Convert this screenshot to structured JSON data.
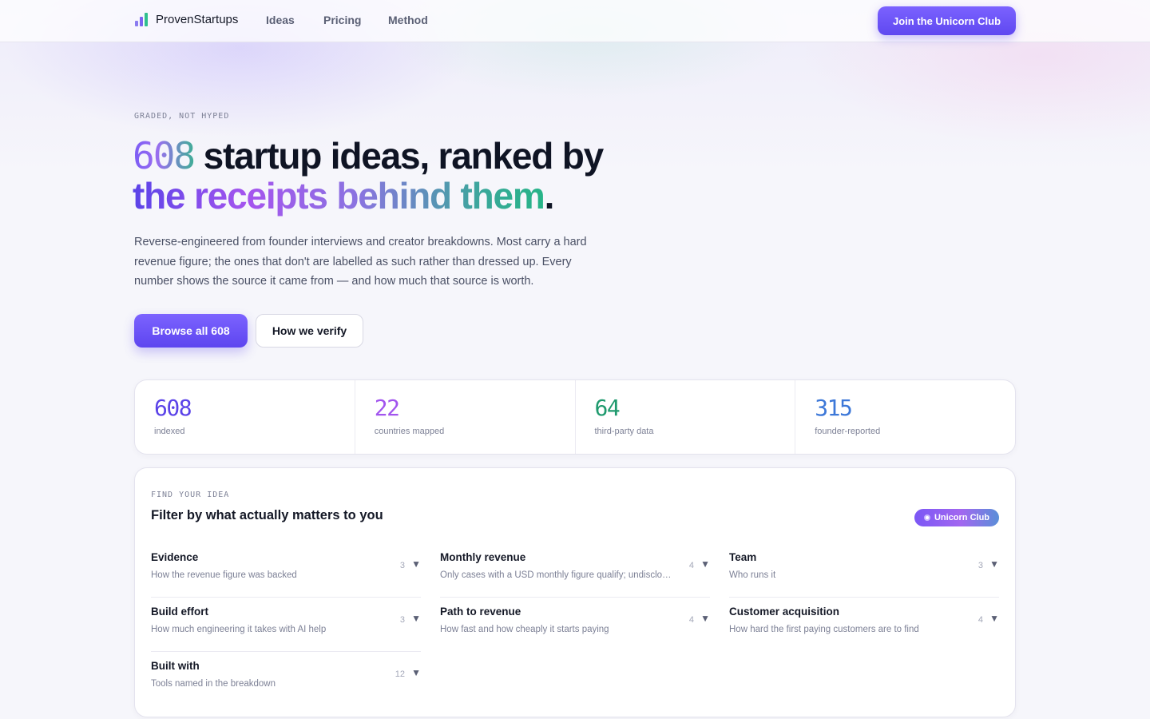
{
  "nav": {
    "brand": "ProvenStartups",
    "links": [
      "Ideas",
      "Pricing",
      "Method"
    ],
    "cta": "Join the Unicorn Club"
  },
  "hero": {
    "eyebrow": "GRADED, NOT HYPED",
    "headline_number": "608",
    "headline_rest_line1": " startup ideas, ranked by",
    "headline_gradient": "the receipts behind them",
    "headline_end": ".",
    "lede": "Reverse-engineered from founder interviews and creator breakdowns. Most carry a hard revenue figure; the ones that don't are labelled as such rather than dressed up. Every number shows the source it came from — and how much that source is worth.",
    "primary_button": "Browse all 608",
    "secondary_button": "How we verify"
  },
  "stats": [
    {
      "value": "608",
      "label": "indexed",
      "color": "#5b43e8"
    },
    {
      "value": "22",
      "label": "countries mapped",
      "color": "#a255ee"
    },
    {
      "value": "64",
      "label": "third-party data",
      "color": "#1f9a6e"
    },
    {
      "value": "315",
      "label": "founder-reported",
      "color": "#3d78d8"
    }
  ],
  "filters_card": {
    "eyebrow": "FIND YOUR IDEA",
    "title": "Filter by what actually matters to you",
    "badge": "Unicorn Club",
    "filters": [
      {
        "name": "Evidence",
        "description": "How the revenue figure was backed",
        "count": "3"
      },
      {
        "name": "Monthly revenue",
        "description": "Only cases with a USD monthly figure qualify; undisclosed ones are excluded",
        "count": "4"
      },
      {
        "name": "Team",
        "description": "Who runs it",
        "count": "3"
      },
      {
        "name": "Build effort",
        "description": "How much engineering it takes with AI help",
        "count": "3"
      },
      {
        "name": "Path to revenue",
        "description": "How fast and how cheaply it starts paying",
        "count": "4"
      },
      {
        "name": "Customer acquisition",
        "description": "How hard the first paying customers are to find",
        "count": "4"
      },
      {
        "name": "Built with",
        "description": "Tools named in the breakdown",
        "count": "12"
      }
    ]
  }
}
